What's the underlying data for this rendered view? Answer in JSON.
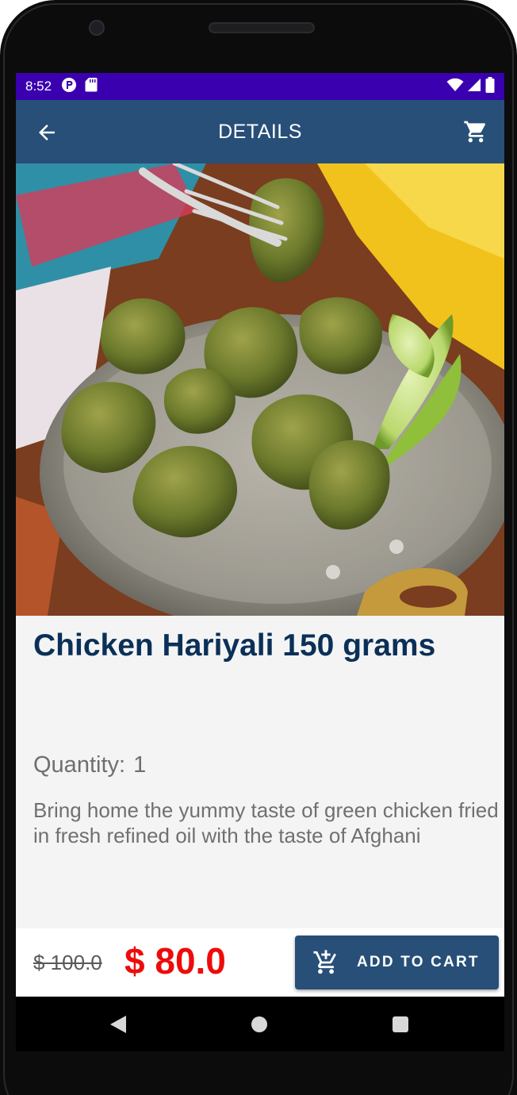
{
  "status_bar": {
    "time": "8:52",
    "left_icons": [
      "p-circle-icon",
      "sd-card-icon"
    ],
    "right_icons": [
      "wifi-icon",
      "signal-icon",
      "battery-icon"
    ],
    "background": "#3a00b0"
  },
  "app_bar": {
    "title": "DETAILS",
    "back_icon": "arrow-back-icon",
    "cart_icon": "shopping-cart-icon",
    "background": "#274f78"
  },
  "product": {
    "image_description_icon": "food-photo",
    "title": "Chicken Hariyali 150 grams",
    "quantity_label": "Quantity:",
    "quantity_value": "1",
    "description": "Bring home the yummy taste of green chicken fried in fresh refined oil with the taste of Afghani"
  },
  "bottom_bar": {
    "old_price": "$ 100.0",
    "new_price": "$ 80.0",
    "add_to_cart_label": "ADD TO CART",
    "add_to_cart_icon": "add-shopping-cart-icon",
    "price_color": "#ee0b0b",
    "button_color": "#274f78"
  },
  "nav_bar": {
    "icons": [
      "nav-back-icon",
      "nav-home-icon",
      "nav-recents-icon"
    ]
  }
}
